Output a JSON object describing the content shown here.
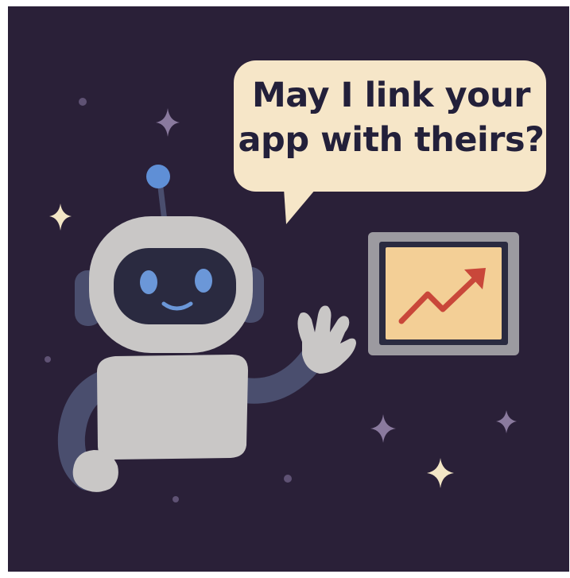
{
  "speech_bubble": {
    "line1": "May I link your",
    "line2": "app with theirs?"
  },
  "colors": {
    "background": "#2a2038",
    "bubble": "#f6e6c8",
    "robot_body": "#c9c7c6",
    "robot_arm": "#4a4e6e",
    "robot_face": "#2a2a40",
    "robot_eyes": "#6b97d8",
    "antenna": "#5f8fd6",
    "chart_panel": "#f3cf96",
    "chart_frame": "#9c9aa0",
    "trend_line": "#c9473a",
    "sparkle": "#f3e6c6",
    "sparkle_dim": "#8a7a9e",
    "dots": "#5f5274"
  },
  "icons": [
    "robot",
    "speech-bubble",
    "trend-chart",
    "sparkle-stars"
  ]
}
